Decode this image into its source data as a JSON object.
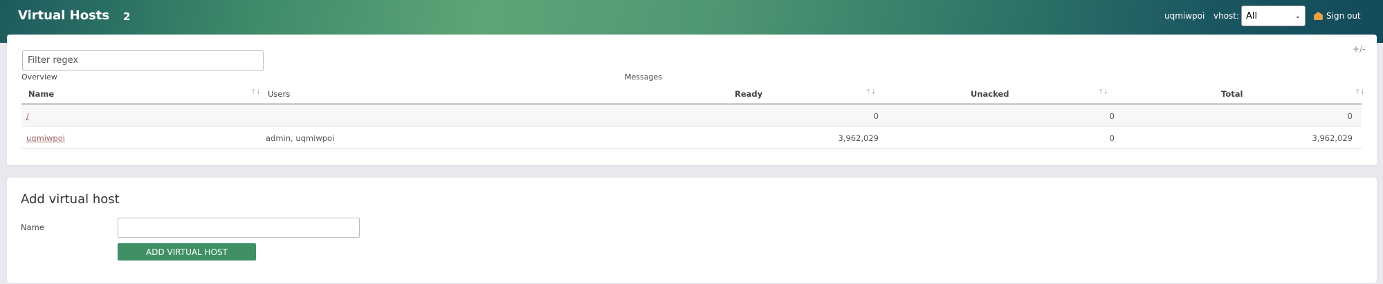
{
  "header": {
    "title": "Virtual Hosts",
    "count": "2",
    "user": "uqmiwpoi",
    "vhost_label": "vhost:",
    "vhost_selected": "All",
    "signout_label": "Sign out"
  },
  "list": {
    "filter_placeholder": "Filter regex",
    "toggle_label": "+/-",
    "groups": {
      "overview": "Overview",
      "messages": "Messages"
    },
    "columns": {
      "name": "Name",
      "users": "Users",
      "ready": "Ready",
      "unacked": "Unacked",
      "total": "Total"
    },
    "rows": [
      {
        "name": "/",
        "users": "",
        "ready": "0",
        "unacked": "0",
        "total": "0"
      },
      {
        "name": "uqmiwpoi",
        "users": "admin, uqmiwpoi",
        "ready": "3,962,029",
        "unacked": "0",
        "total": "3,962,029"
      }
    ]
  },
  "add": {
    "title": "Add virtual host",
    "name_label": "Name",
    "name_value": "",
    "button_label": "Add virtual host"
  },
  "colors": {
    "accent": "#3f9065",
    "link": "#a26060"
  }
}
